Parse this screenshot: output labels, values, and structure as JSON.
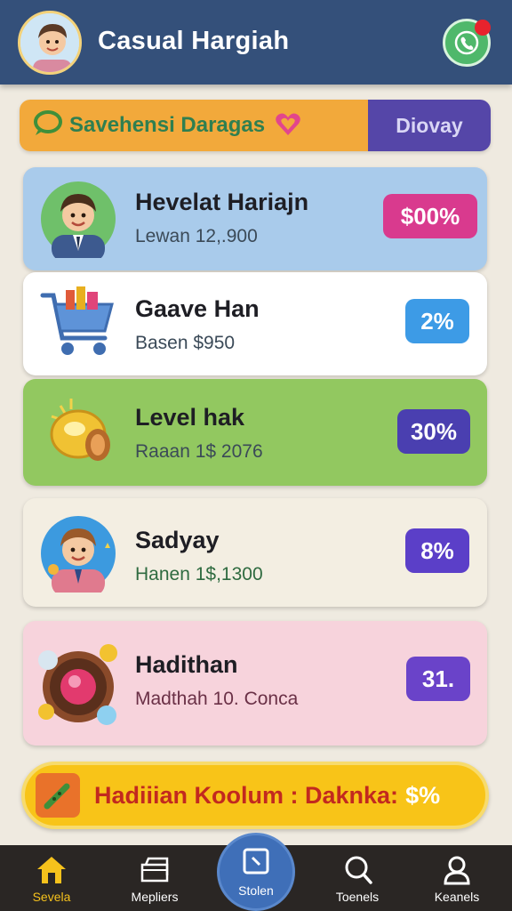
{
  "header": {
    "title": "Casual Hargiah",
    "avatar_icon": "boy-avatar-icon",
    "action_icon": "phone-chat-icon",
    "notification_dot": true
  },
  "banner": {
    "icon": "chat-bubble-icon",
    "text": "Savehensi Daragas",
    "heart_icon": "heart-icon",
    "button": "Diovay"
  },
  "cards": [
    {
      "title": "Hevelat Hariajn",
      "subtitle": "Lewan 12,.900",
      "badge": "$00%",
      "badge_color": "#d93a8e",
      "bg": "#a9cbeb",
      "icon": "boy-avatar-icon"
    },
    {
      "title": "Gaave Han",
      "subtitle": "Basen $950",
      "badge": "2%",
      "badge_color": "#3d9be6",
      "bg": "#ffffff",
      "icon": "shopping-cart-icon"
    },
    {
      "title": "Level hak",
      "subtitle": "Raaan 1$ 2076",
      "badge": "30%",
      "badge_color": "#4a3fb0",
      "bg": "#92c860",
      "icon": "golden-bell-icon"
    },
    {
      "title": "Sadyay",
      "subtitle": "Hanen 1$,1300",
      "badge": "8%",
      "badge_color": "#5b3fc8",
      "bg": "#f3eee2",
      "icon": "boy-avatar-icon"
    },
    {
      "title": "Hadithan",
      "subtitle": "Madthah 10. Conca",
      "badge": "31.",
      "badge_color": "#6a43c9",
      "bg": "#f7d3dc",
      "icon": "roulette-wheel-icon"
    }
  ],
  "promo": {
    "icon": "flute-icon",
    "text": "Hadiiian Koolum : Daknka:",
    "tail": "$%"
  },
  "nav": {
    "items": [
      {
        "label": "Sevela",
        "icon": "home-icon",
        "active": true
      },
      {
        "label": "Mepliers",
        "icon": "stack-icon"
      },
      {
        "label": "Stolen",
        "icon": "tablet-icon"
      },
      {
        "label": "Toenels",
        "icon": "search-icon"
      },
      {
        "label": "Keanels",
        "icon": "user-icon"
      }
    ]
  },
  "colors": {
    "header_bg": "#34507a",
    "banner_left": "#f2a93b",
    "banner_right": "#5546a8",
    "promo_bg": "#f8c418",
    "nav_bg": "#2a2624",
    "nav_active": "#f6c21c"
  }
}
